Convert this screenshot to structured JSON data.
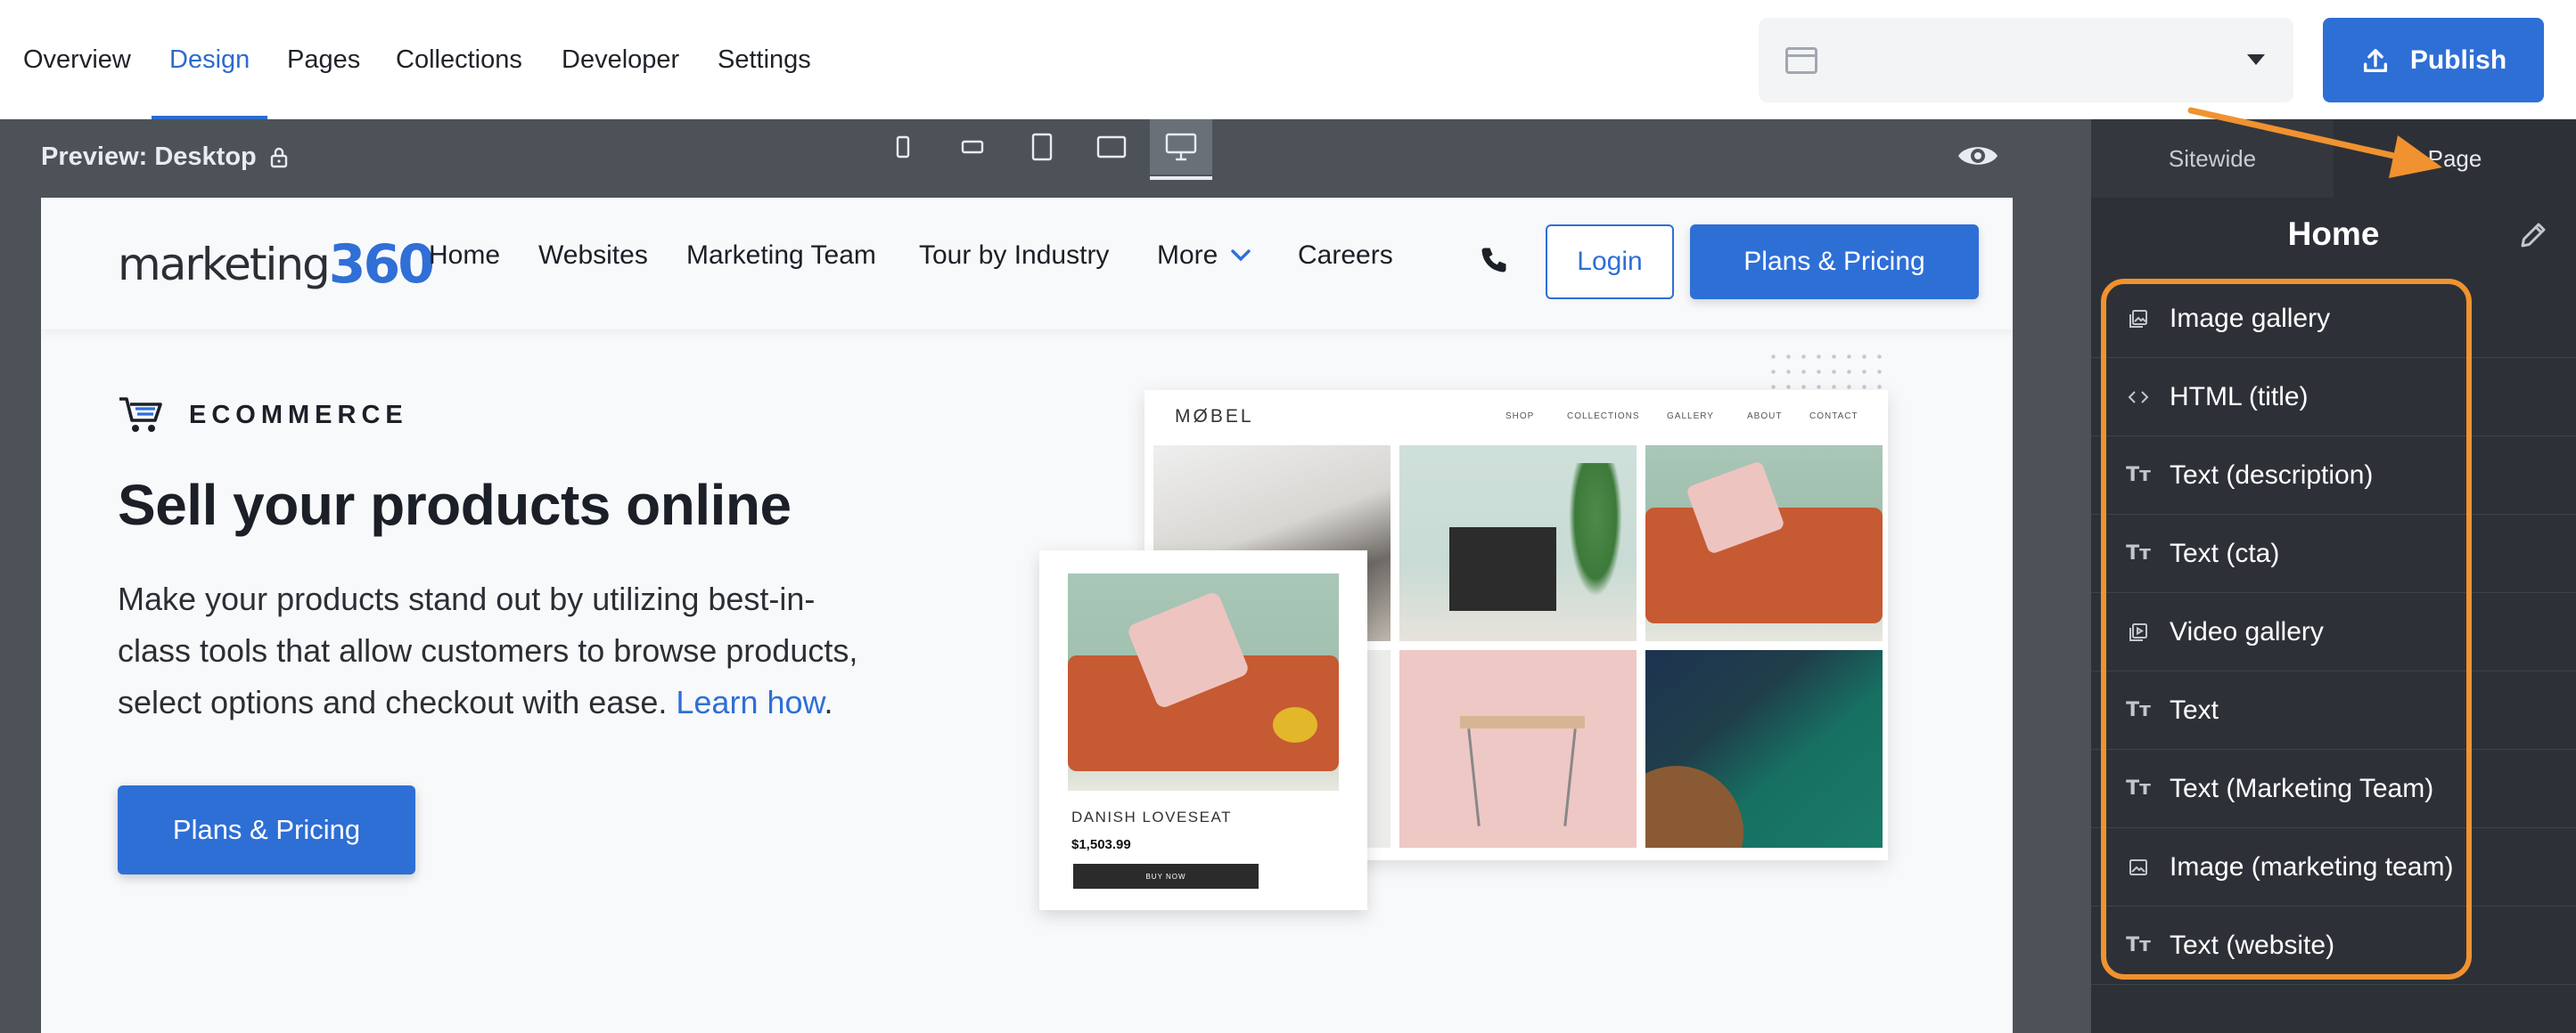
{
  "topnav": {
    "tabs": [
      "Overview",
      "Design",
      "Pages",
      "Collections",
      "Developer",
      "Settings"
    ],
    "active": "Design"
  },
  "page_select": {
    "value": ""
  },
  "publish": {
    "label": "Publish"
  },
  "preview": {
    "label": "Preview: Desktop",
    "devices": [
      "mobile-portrait",
      "mobile-landscape",
      "tablet-portrait",
      "tablet-landscape",
      "desktop"
    ],
    "active_device": "desktop"
  },
  "site": {
    "logo_word": "marketing",
    "logo_num": "360",
    "nav": {
      "home": "Home",
      "websites": "Websites",
      "marketing_team": "Marketing Team",
      "tour": "Tour by Industry",
      "more": "More",
      "careers": "Careers"
    },
    "login": "Login",
    "plans_top": "Plans & Pricing",
    "eyebrow": "ECOMMERCE",
    "title": "Sell your products online",
    "desc_main": "Make your products stand out by utilizing best-in-class tools that allow customers to browse products, select options and checkout with ease. ",
    "desc_link": "Learn how",
    "desc_end": ".",
    "plans_hero": "Plans & Pricing",
    "mockup": {
      "brand": "MØBEL",
      "nav": [
        "SHOP",
        "COLLECTIONS",
        "GALLERY",
        "ABOUT",
        "CONTACT"
      ],
      "product_name": "DANISH LOVESEAT",
      "product_price": "$1,503.99",
      "buy_now": "BUY NOW"
    }
  },
  "right_panel": {
    "tabs": {
      "sitewide": "Sitewide",
      "page": "Page"
    },
    "title": "Home",
    "sections": [
      {
        "label": "Image gallery",
        "icon": "image-gallery-icon"
      },
      {
        "label": "HTML (title)",
        "icon": "code-icon"
      },
      {
        "label": "Text (description)",
        "icon": "text-icon"
      },
      {
        "label": "Text (cta)",
        "icon": "text-icon"
      },
      {
        "label": "Video gallery",
        "icon": "video-gallery-icon"
      },
      {
        "label": "Text",
        "icon": "text-icon"
      },
      {
        "label": "Text (Marketing Team)",
        "icon": "text-icon"
      },
      {
        "label": "Image (marketing team)",
        "icon": "image-icon"
      },
      {
        "label": "Text (website)",
        "icon": "text-icon"
      }
    ]
  },
  "colors": {
    "accent": "#2e6fd6",
    "annotation": "#f0922f",
    "panel_bg": "#2d3137",
    "preview_bg": "#4d5259"
  }
}
